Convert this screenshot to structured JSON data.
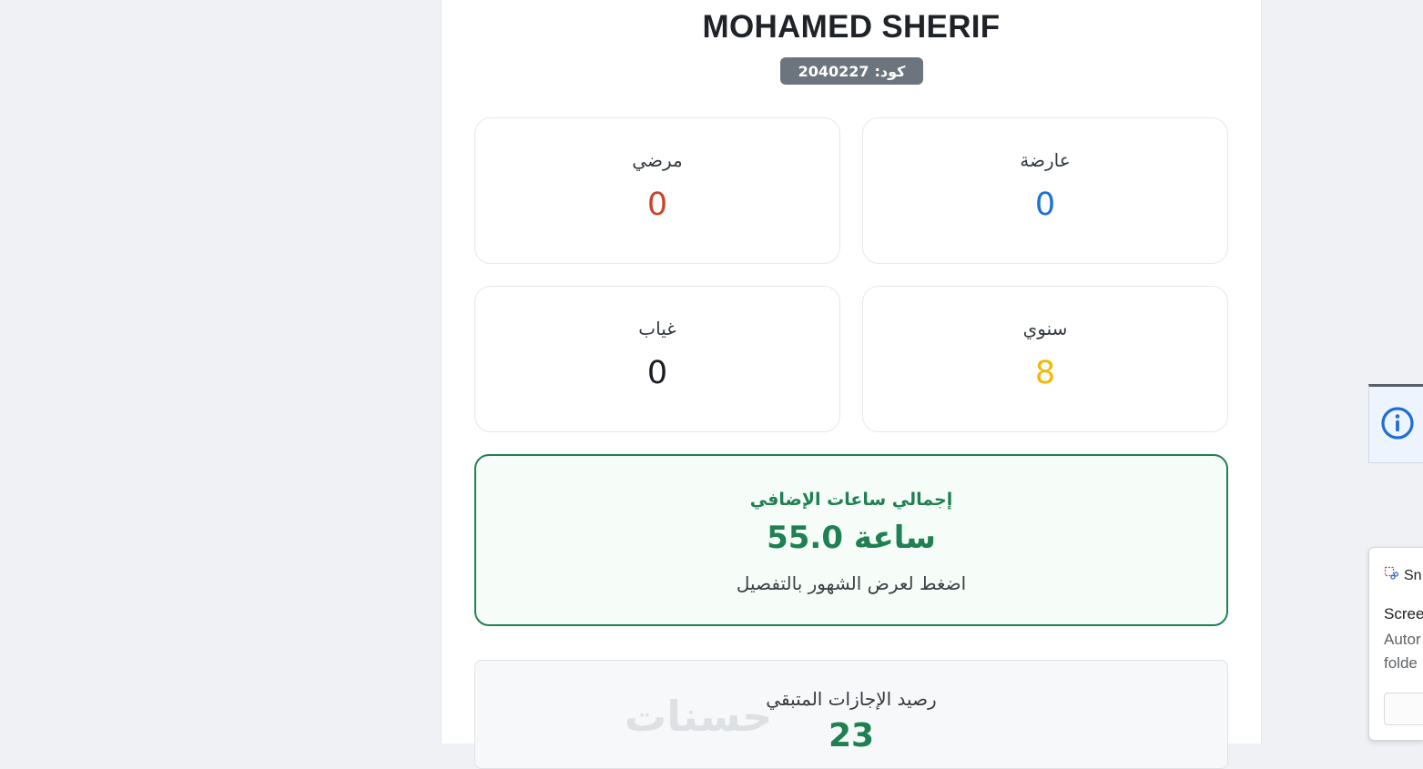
{
  "employee": {
    "name": "MOHAMED SHERIF",
    "code_label": "كود:",
    "code_value": "2040227"
  },
  "stats": {
    "sick": {
      "label": "مرضي",
      "value": "0",
      "color": "#c8462a"
    },
    "casual": {
      "label": "عارضة",
      "value": "0",
      "color": "#1e6fd9"
    },
    "absent": {
      "label": "غياب",
      "value": "0",
      "color": "#1a1d21"
    },
    "annual": {
      "label": "سنوي",
      "value": "8",
      "color": "#f2b705"
    }
  },
  "overtime": {
    "title": "إجمالي ساعات الإضافي",
    "value": "55.0 ساعة",
    "hint": "اضغط لعرض الشهور بالتفصيل",
    "color": "#1f8052"
  },
  "balance": {
    "title": "رصيد الإجازات المتبقي",
    "value": "23",
    "watermark": "حسنات"
  },
  "side_widgets": {
    "info_icon": "info-icon",
    "snip": {
      "app_name": "Sn",
      "title": "Scree",
      "body_line1": "Autor",
      "body_line2": "folde"
    }
  }
}
